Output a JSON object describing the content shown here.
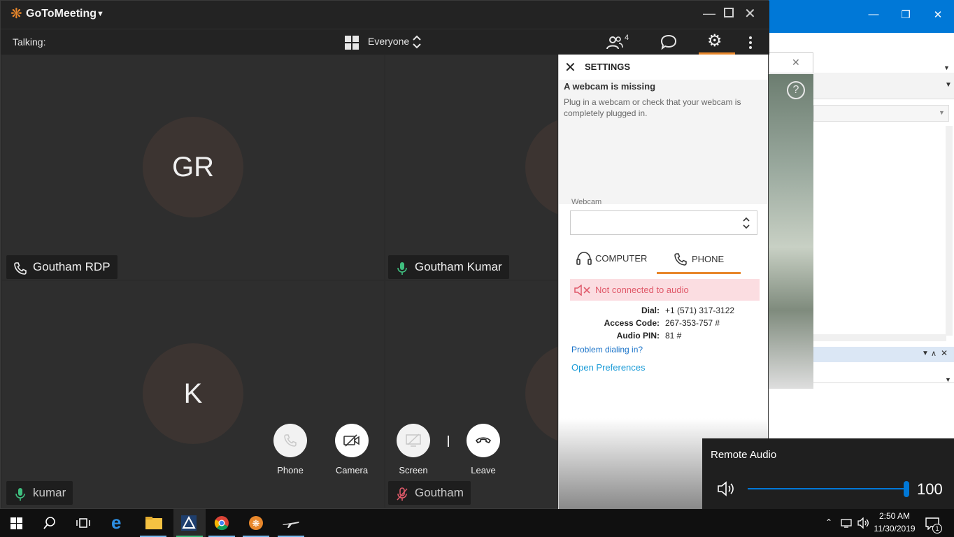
{
  "app": {
    "brand": "GoToMeeting",
    "talking_label": "Talking:",
    "layout_label": "Everyone",
    "participant_count": "4"
  },
  "tiles": [
    {
      "initials": "GR",
      "name": "Goutham RDP",
      "audio": "phone"
    },
    {
      "initials": "",
      "name": "Goutham Kumar",
      "audio": "mic"
    },
    {
      "initials": "K",
      "name": "kumar",
      "audio": "mic"
    },
    {
      "initials": "",
      "name": "Goutham",
      "audio": "mic-muted"
    }
  ],
  "controls": {
    "phone": "Phone",
    "camera": "Camera",
    "screen": "Screen",
    "leave": "Leave"
  },
  "settings": {
    "title": "SETTINGS",
    "webcam_heading": "A webcam is missing",
    "webcam_message": "Plug in a webcam or check that your webcam is completely plugged in.",
    "webcam_label": "Webcam",
    "webcam_value": "",
    "tab_computer": "COMPUTER",
    "tab_phone": "PHONE",
    "status": "Not connected to audio",
    "dial_label": "Dial:",
    "dial_value": "+1 (571) 317-3122",
    "access_label": "Access Code:",
    "access_value": "267-353-757 #",
    "pin_label": "Audio PIN:",
    "pin_value": "81 #",
    "problem_link": "Problem dialing in?",
    "prefs_link": "Open Preferences"
  },
  "remote_audio": {
    "title": "Remote Audio",
    "volume": "100",
    "volume_fraction": 1.0
  },
  "taskbar": {
    "time": "2:50 AM",
    "date": "11/30/2019",
    "notification_count": "1"
  },
  "colors": {
    "accent_orange": "#e8872b",
    "mic_green": "#3fbf7f",
    "link_blue": "#1a73c8",
    "error_red": "#e05a6a",
    "win_blue": "#0078d7"
  }
}
